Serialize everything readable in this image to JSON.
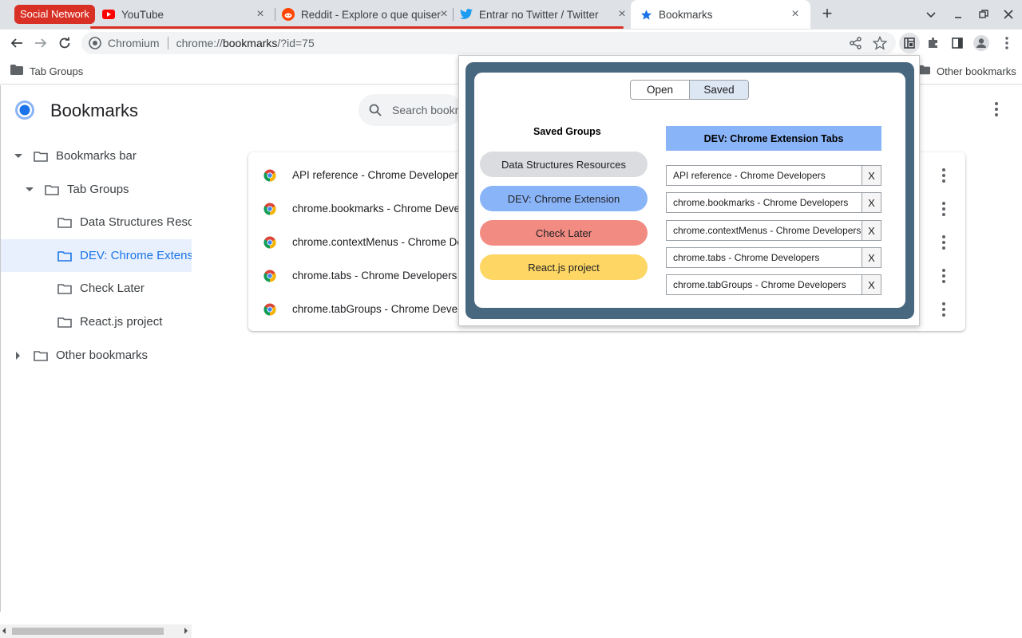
{
  "browser": {
    "tab_group_label": "Social Network",
    "tabs": [
      {
        "title": "YouTube",
        "icon": "youtube-icon"
      },
      {
        "title": "Reddit - Explore o que quiser",
        "icon": "reddit-icon"
      },
      {
        "title": "Entrar no Twitter / Twitter",
        "icon": "twitter-icon"
      },
      {
        "title": "Bookmarks",
        "icon": "star-icon"
      }
    ],
    "new_tab_label": "+",
    "close_glyph": "×",
    "omnibox": {
      "site_label": "Chromium",
      "url_scheme": "chrome://",
      "url_host": "bookmarks",
      "url_rest": "/?id=75"
    },
    "bookmarks_bar": {
      "left_item": "Tab Groups",
      "right_item": "Other bookmarks"
    }
  },
  "bookmarks_page": {
    "title": "Bookmarks",
    "search_placeholder": "Search bookmarks",
    "tree": [
      {
        "label": "Bookmarks bar",
        "level": 0,
        "arrow": "down"
      },
      {
        "label": "Tab Groups",
        "level": 1,
        "arrow": "down"
      },
      {
        "label": "Data Structures Resources",
        "level": 2,
        "arrow": "none"
      },
      {
        "label": "DEV: Chrome Extension",
        "level": 2,
        "arrow": "none",
        "selected": true
      },
      {
        "label": "Check Later",
        "level": 2,
        "arrow": "none"
      },
      {
        "label": "React.js project",
        "level": 2,
        "arrow": "none"
      },
      {
        "label": "Other bookmarks",
        "level": 0,
        "arrow": "right"
      }
    ],
    "bookmarks": [
      "API reference - Chrome Developers",
      "chrome.bookmarks - Chrome Developers",
      "chrome.contextMenus - Chrome Developers",
      "chrome.tabs - Chrome Developers",
      "chrome.tabGroups - Chrome Developers"
    ]
  },
  "extension_popup": {
    "segment_open": "Open",
    "segment_saved": "Saved",
    "active_segment": "Saved",
    "saved_groups_title": "Saved Groups",
    "groups": [
      {
        "label": "Data Structures Resources",
        "color": "#dadce0"
      },
      {
        "label": "DEV: Chrome Extension",
        "color": "#8ab4f8"
      },
      {
        "label": "Check Later",
        "color": "#f28b82"
      },
      {
        "label": "React.js project",
        "color": "#fdd663"
      }
    ],
    "tabs_header": "DEV: Chrome Extension Tabs",
    "tabs_header_color": "#8ab4f8",
    "tabs": [
      "API reference - Chrome Developers",
      "chrome.bookmarks - Chrome Developers",
      "chrome.contextMenus - Chrome Developers",
      "chrome.tabs - Chrome Developers",
      "chrome.tabGroups - Chrome Developers"
    ],
    "remove_label": "X"
  },
  "colors": {
    "accent": "#1a73e8",
    "group_red": "#d93025",
    "popup_frame": "#486880"
  }
}
